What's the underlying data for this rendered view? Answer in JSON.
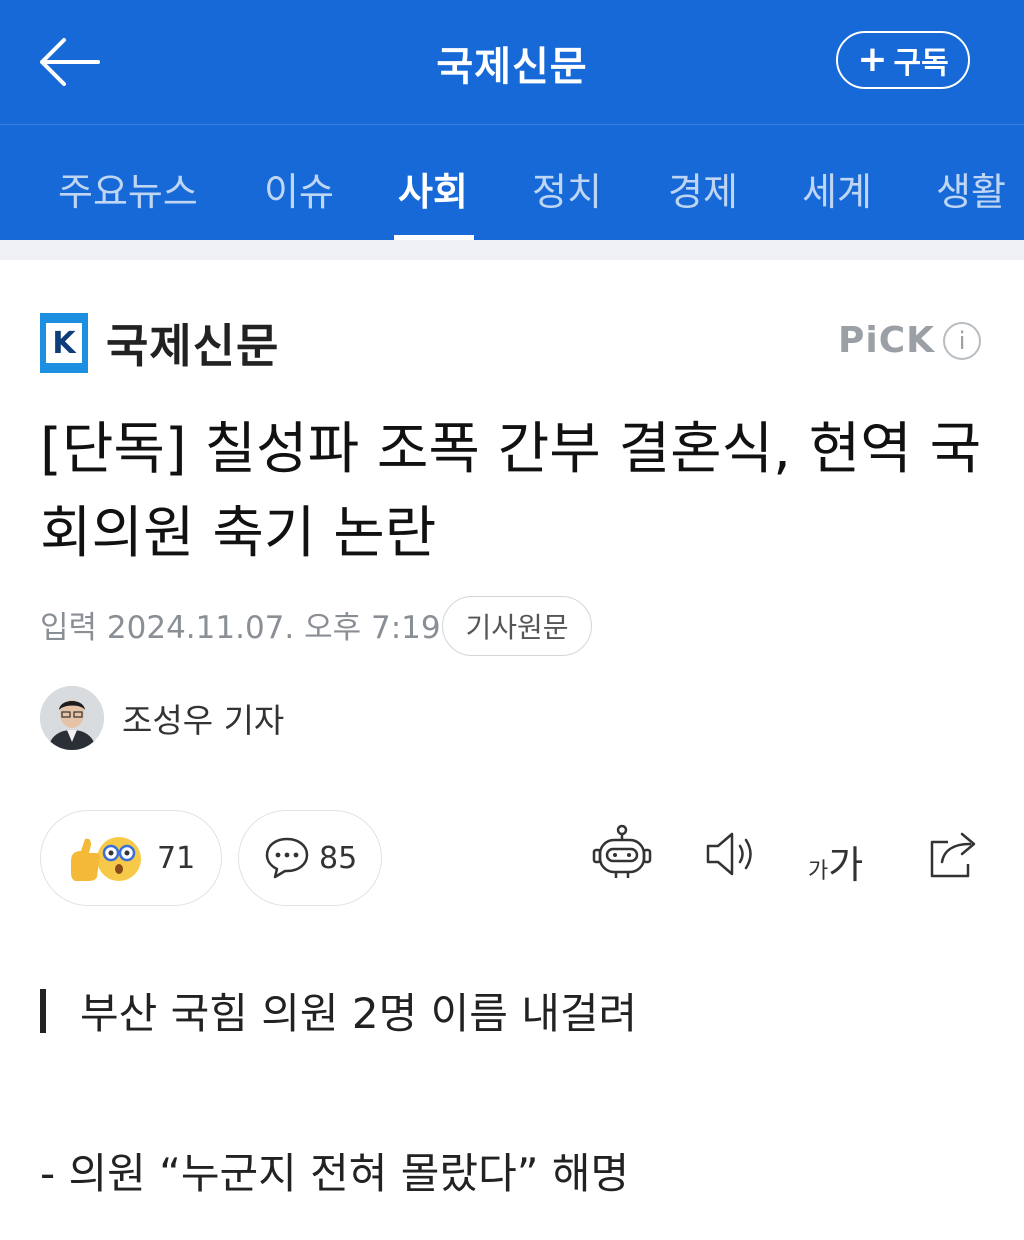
{
  "header": {
    "title": "국제신문",
    "subscribe_label": "구독",
    "back_icon": "arrow-left-icon",
    "plus_icon": "plus-icon"
  },
  "tabs": [
    {
      "label": "주요뉴스",
      "active": false
    },
    {
      "label": "이슈",
      "active": false
    },
    {
      "label": "사회",
      "active": true
    },
    {
      "label": "정치",
      "active": false
    },
    {
      "label": "경제",
      "active": false
    },
    {
      "label": "세계",
      "active": false
    },
    {
      "label": "생활",
      "active": false
    }
  ],
  "article": {
    "brand_mark": "K",
    "brand_name": "국제신문",
    "pick_label": "PiCK",
    "headline": "[단독] 칠성파 조폭 간부 결혼식, 현역 국회의원 축기 논란",
    "date": "입력 2024.11.07. 오후 7:19",
    "original_button": "기사원문",
    "author": "조성우 기자",
    "reaction_count": "71",
    "comment_count": "85",
    "fontsize_small": "가",
    "fontsize_large": "가",
    "subheading": "부산 국힘 의원 2명 이름 내걸려",
    "subline": "- 의원 “누군지 전혀 몰랐다” 해명"
  },
  "colors": {
    "brand_blue": "#1769d8",
    "text": "#111111",
    "muted": "#8a8f95"
  }
}
